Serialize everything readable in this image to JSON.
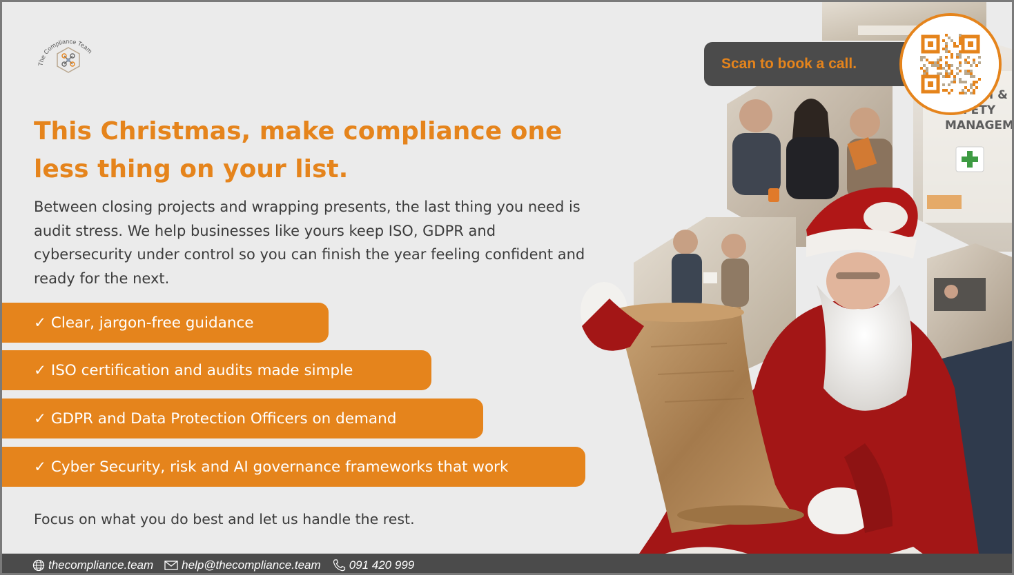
{
  "logo": {
    "brand_text": "The Compliance Team",
    "icon": "hexagon-network-icon"
  },
  "headline": "This Christmas, make compliance one less thing on your list.",
  "intro": "Between closing projects and wrapping presents, the last thing you need is audit stress. We help businesses like yours keep ISO, GDPR and cybersecurity under control so you can finish the year feeling confident and ready for the next.",
  "bullets": [
    "✓ Clear, jargon-free guidance",
    "✓ ISO certification and audits made simple",
    "✓ GDPR and Data Protection Officers on demand",
    "✓ Cyber Security, risk and AI governance frameworks that work"
  ],
  "tagline": "Focus on what you do best and let us handle the rest.",
  "cta": {
    "label": "Scan to book a call.",
    "qr_icon": "qr-code-icon"
  },
  "photo_sign": {
    "line1": "H &",
    "line2": "FETY",
    "line3": "MANAGEM"
  },
  "footer": {
    "website": "thecompliance.team",
    "email": "help@thecompliance.team",
    "phone": "091 420 999",
    "icons": [
      "globe-icon",
      "mail-icon",
      "phone-icon"
    ]
  },
  "colors": {
    "accent": "#e5841c",
    "dark": "#4b4b4b",
    "background": "#ebebeb",
    "text": "#3b3b3b",
    "santa_red": "#a31616"
  }
}
